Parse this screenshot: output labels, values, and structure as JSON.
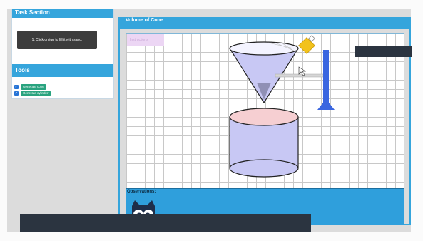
{
  "left_panel": {
    "task_section_title": "Task Section",
    "task_button_label": "1. Click on jug to fill it with sand.",
    "tools_title": "Tools",
    "tools": [
      {
        "label": "Generate cone",
        "checked": true
      },
      {
        "label": "Generate cylinder",
        "checked": true
      }
    ]
  },
  "right_panel": {
    "title": "Volume of Cone",
    "info_chip": "Instructions",
    "observations_label": "Observations:"
  },
  "colors": {
    "header_blue": "#35a5dc",
    "cone_fill": "#c8c8f4",
    "cylinder_fill": "#c8c8f4",
    "cylinder_top": "#f6cfd2",
    "jug": "#f2c21b",
    "stand": "#3a66e0",
    "dark_bar": "#2b3440"
  }
}
